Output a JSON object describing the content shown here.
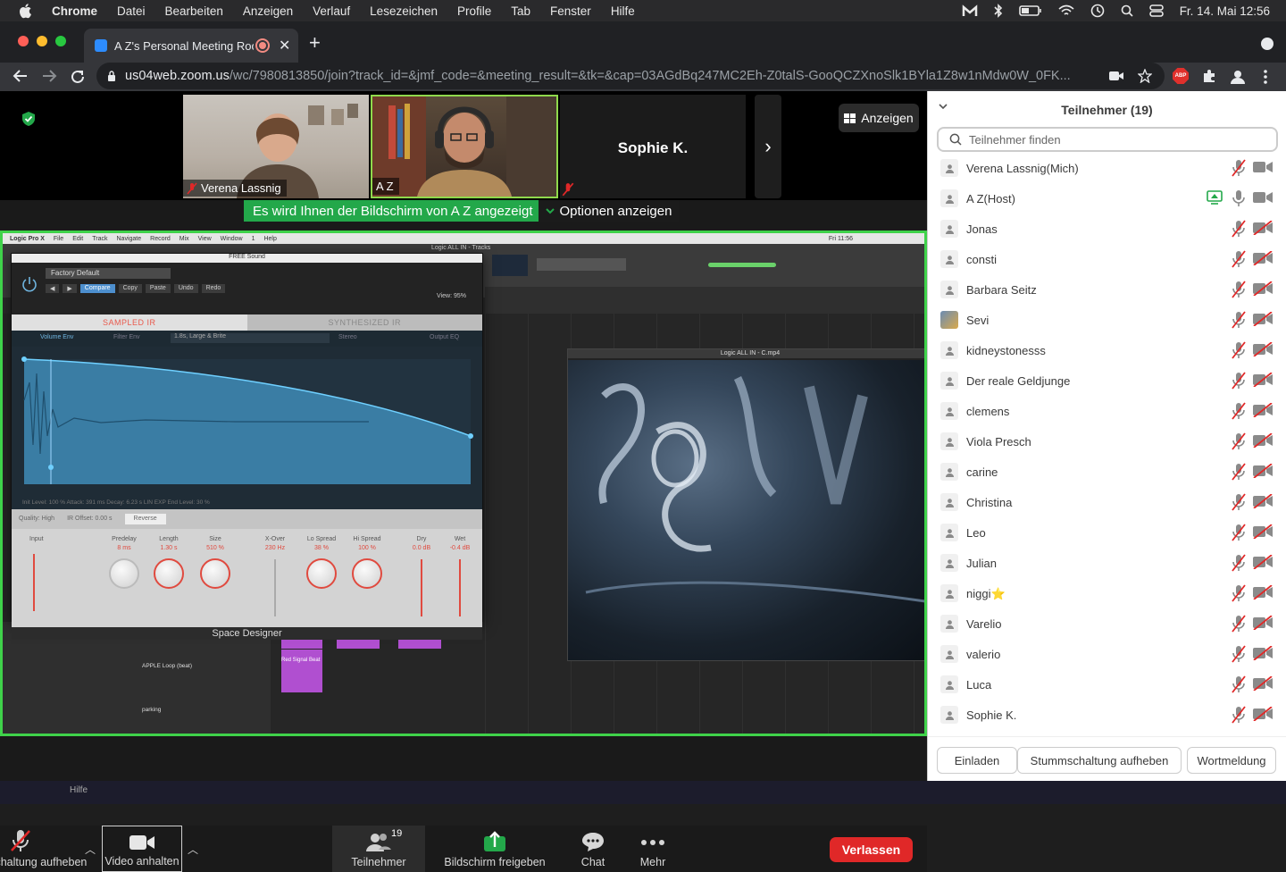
{
  "menubar": {
    "app": "Chrome",
    "items": [
      "Datei",
      "Bearbeiten",
      "Anzeigen",
      "Verlauf",
      "Lesezeichen",
      "Profile",
      "Tab",
      "Fenster",
      "Hilfe"
    ],
    "clock": "Fr. 14. Mai  12:56"
  },
  "browser": {
    "tab_title": "A Z's Personal Meeting Room",
    "url_host": "us04web.zoom.us",
    "url_path": "/wc/7980813850/join?track_id=&jmf_code=&meeting_result=&tk=&cap=03AGdBq247MC2Eh-Z0talS-GooQCZXnoSlk1BYla1Z8w1nMdw0W_0FK...",
    "ext_abp": "ABP"
  },
  "meeting": {
    "tiles": [
      {
        "name": "Verena Lassnig"
      },
      {
        "name": "A Z"
      },
      {
        "name": "Sophie K."
      }
    ],
    "view_button": "Anzeigen",
    "share_banner": "Es wird Ihnen der Bildschirm von A Z angezeigt",
    "share_options": "Optionen anzeigen"
  },
  "shared_screen": {
    "menu": [
      "Logic Pro X",
      "File",
      "Edit",
      "Track",
      "Navigate",
      "Record",
      "Mix",
      "View",
      "Window",
      "1",
      "Help"
    ],
    "clock": "Fri 11:56",
    "window_title": "Logic ALL IN - Tracks",
    "plugin_title": "FREE Sound",
    "preset": "Factory Default",
    "buttons": [
      "Compare",
      "Copy",
      "Paste",
      "Undo",
      "Redo"
    ],
    "view_zoom": "95%",
    "tab_sampled": "SAMPLED IR",
    "tab_synth": "SYNTHESIZED IR",
    "env_labels": [
      "Volume Env",
      "Filter Env",
      "1.8s, Large & Brite",
      "Stereo",
      "Output EQ"
    ],
    "params": "Init Level: 100 %    Attack: 391 ms    Decay: 6.23 s    LIN  EXP    End Level: 30 %",
    "quality": [
      "Quality: High",
      "IR Offset: 0.00 s",
      "Reverse"
    ],
    "knobs": [
      {
        "label": "Predelay",
        "value": "8 ms"
      },
      {
        "label": "Length",
        "value": "1.30 s"
      },
      {
        "label": "Size",
        "value": "510 %"
      },
      {
        "label": "X-Over",
        "value": "230 Hz"
      },
      {
        "label": "Lo Spread",
        "value": "38 %"
      },
      {
        "label": "Hi Spread",
        "value": "100 %"
      },
      {
        "label": "Dry",
        "value": "0.0 dB"
      },
      {
        "label": "Wet",
        "value": "-0.4 dB"
      }
    ],
    "input_label": "Input",
    "plugin_name": "Space Designer",
    "video_title": "Logic ALL IN - C.mp4",
    "tracks": [
      "APPLE Loop (beat)",
      "parking"
    ],
    "region_label": "Red Signal Beat"
  },
  "controls": {
    "mute": "Stummschaltung aufheben",
    "video": "Video anhalten",
    "participants": "Teilnehmer",
    "participants_count": "19",
    "share": "Bildschirm freigeben",
    "chat": "Chat",
    "more": "Mehr",
    "leave": "Verlassen"
  },
  "panel": {
    "title": "Teilnehmer (19)",
    "search_placeholder": "Teilnehmer finden",
    "participants": [
      {
        "name": "Verena Lassnig(Mich)",
        "mic": "muted",
        "cam": "on"
      },
      {
        "name": "A Z(Host)",
        "mic": "on",
        "cam": "on",
        "sharing": true
      },
      {
        "name": "Jonas",
        "mic": "muted",
        "cam": "off"
      },
      {
        "name": "consti",
        "mic": "muted",
        "cam": "off"
      },
      {
        "name": "Barbara Seitz",
        "mic": "muted",
        "cam": "off"
      },
      {
        "name": "Sevi",
        "mic": "muted",
        "cam": "off",
        "photo": true
      },
      {
        "name": "kidneystonesss",
        "mic": "muted",
        "cam": "off"
      },
      {
        "name": "Der reale Geldjunge",
        "mic": "muted",
        "cam": "off"
      },
      {
        "name": "clemens",
        "mic": "muted",
        "cam": "off"
      },
      {
        "name": "Viola Presch",
        "mic": "muted",
        "cam": "off"
      },
      {
        "name": "carine",
        "mic": "muted",
        "cam": "off"
      },
      {
        "name": "Christina",
        "mic": "muted",
        "cam": "off"
      },
      {
        "name": "Leo",
        "mic": "muted",
        "cam": "off"
      },
      {
        "name": "Julian",
        "mic": "muted",
        "cam": "off"
      },
      {
        "name": "niggi⭐",
        "mic": "muted",
        "cam": "off"
      },
      {
        "name": "Varelio",
        "mic": "muted",
        "cam": "off"
      },
      {
        "name": "valerio",
        "mic": "muted",
        "cam": "off"
      },
      {
        "name": "Luca",
        "mic": "muted",
        "cam": "off"
      },
      {
        "name": "Sophie K.",
        "mic": "muted",
        "cam": "off"
      }
    ],
    "invite": "Einladen",
    "unmute_all": "Stummschaltung aufheben",
    "raise_hand": "Wortmeldung"
  },
  "dock": {
    "help": "Hilfe"
  },
  "colors": {
    "zoom_green": "#23a84a",
    "leave_red": "#e02828",
    "zoom_blue": "#2d8cff",
    "muted_red": "#e02828"
  }
}
